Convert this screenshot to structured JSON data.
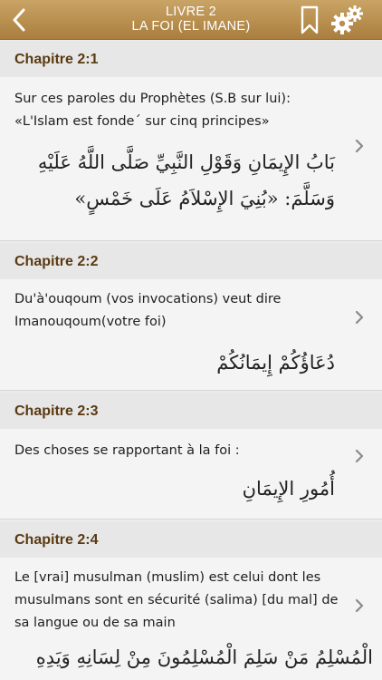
{
  "header": {
    "title_line1": "LIVRE 2",
    "title_line2": "LA FOI (EL IMANE)",
    "icons": {
      "back": "chevron-left-icon",
      "bookmark": "bookmark-icon",
      "settings": "gears-icon"
    },
    "colors": {
      "bar": "#b88f4f",
      "text": "#ffffff"
    }
  },
  "chapters": [
    {
      "title": "Chapitre 2:1",
      "french": "Sur ces paroles du Prophètes (S.B sur lui): «L'Islam est fonde´ sur cinq principes»",
      "arabic": "بَابُ الإِيمَانِ وَقَوْلِ النَّبِيِّ صَلَّى اللَّهُ عَلَيْهِ وَسَلَّمَ: «بُنِيَ الإِسْلاَمُ عَلَى خَمْسٍ»"
    },
    {
      "title": "Chapitre 2:2",
      "french": "Du'à'ouqoum (vos invocations) veut dire Imanouqoum(votre foi)",
      "arabic": "دُعَاؤُكُمْ إِيمَانُكُمْ"
    },
    {
      "title": "Chapitre 2:3",
      "french": "Des choses se rapportant à la foi :",
      "arabic": "أُمُورِ الإِيمَانِ"
    },
    {
      "title": "Chapitre 2:4",
      "french": "Le [vrai] musulman (muslim) est celui dont les musulmans sont en sécurité (salima) [du mal] de sa langue ou de sa main",
      "arabic": "الْمُسْلِمُ مَنْ سَلِمَ الْمُسْلِمُونَ مِنْ لِسَانِهِ وَيَدِهِ"
    }
  ],
  "colors": {
    "chapter_title": "#5a3a12",
    "head_bg": "#e7e7e7",
    "body_bg": "#f4f4f4",
    "chevron": "#8a8a8a"
  }
}
